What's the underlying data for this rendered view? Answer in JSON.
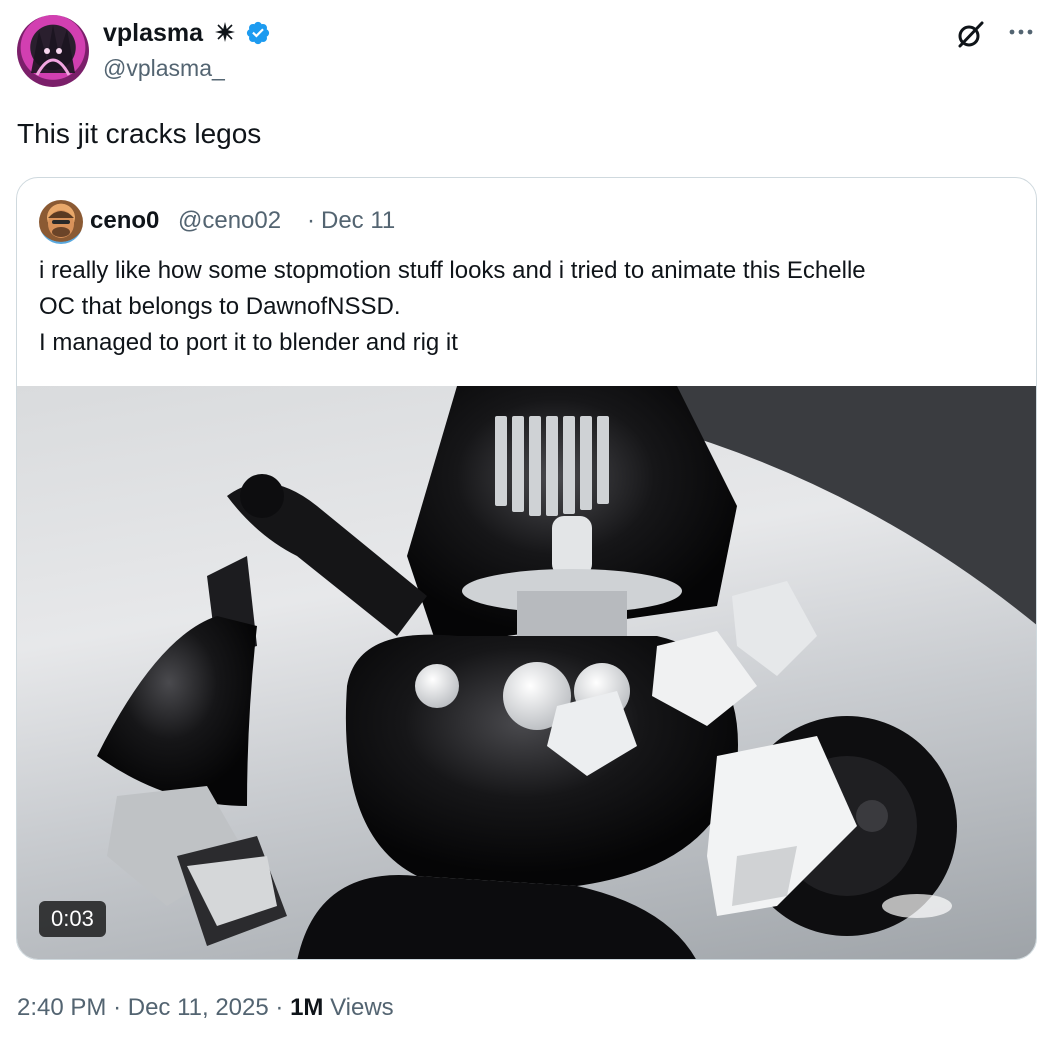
{
  "tweet": {
    "author": {
      "display_name": "vplasma",
      "handle": "@vplasma_",
      "verified": true,
      "avatar_icon": "profile-avatar",
      "name_symbol_icon": "star-icon"
    },
    "text": "This jit cracks legos",
    "timestamp": "2:40 PM",
    "date": "Dec 11, 2025",
    "views_count": "1M",
    "views_label": "Views",
    "separator": "·"
  },
  "quoted_tweet": {
    "author": {
      "display_name": "ceno0",
      "handle": "@ceno02",
      "avatar_icon": "profile-avatar"
    },
    "separator": "·",
    "date": "Dec 11",
    "text_lines": [
      "i really like how some stopmotion stuff looks and i tried to animate this Echelle",
      "OC that belongs to DawnofNSSD.",
      "I managed to port it to blender and rig it"
    ],
    "media": {
      "type": "video",
      "duration": "0:03"
    }
  },
  "icons": {
    "grok": "grok-icon",
    "more": "more-options-icon",
    "verified": "verified-badge-icon"
  },
  "colors": {
    "text_primary": "#0f1419",
    "text_secondary": "#536471",
    "verified_blue": "#1d9bf0",
    "border": "#cfd9de"
  }
}
